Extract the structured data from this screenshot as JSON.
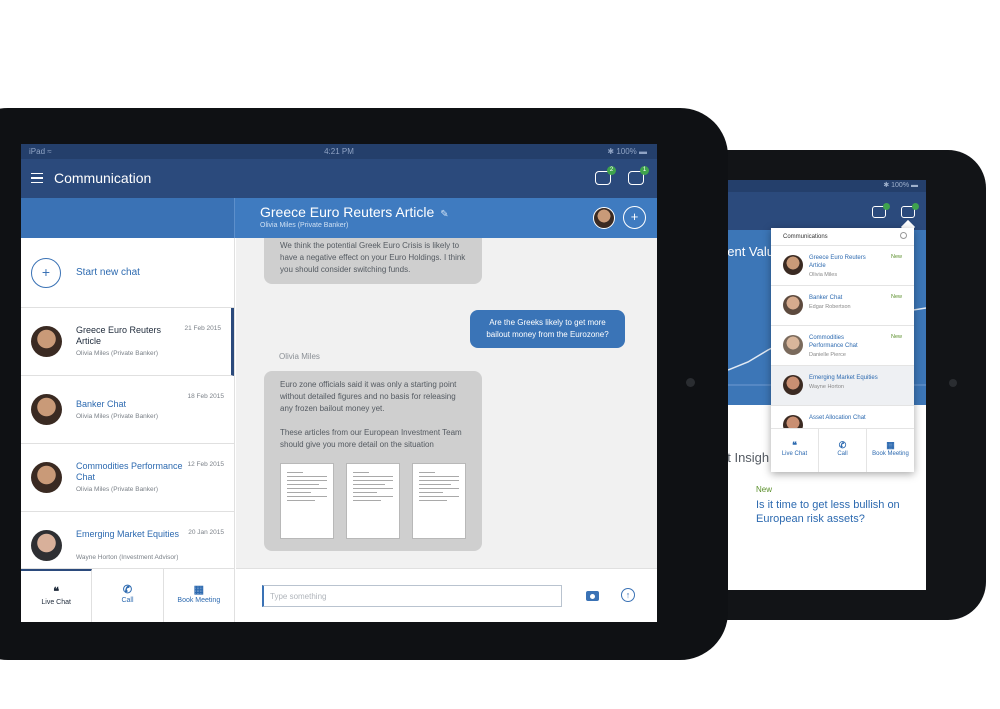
{
  "colors": {
    "header": "#2b4a7c",
    "accent": "#3a72b5",
    "new_badge": "#5a8f2a"
  },
  "status_bar": {
    "left": "iPad ≈",
    "time": "4:21 PM",
    "right": "✱ 100% ▬"
  },
  "header": {
    "title": "Communication",
    "notes_badge": "2",
    "chat_badge": "1"
  },
  "conversation": {
    "title": "Greece Euro Reuters Article",
    "subtitle": "Olivia Miles (Private Banker)",
    "messages": [
      {
        "id": "m1",
        "dir": "in",
        "text": "We think the potential Greek Euro Crisis is likely to have a negative effect on your Euro Holdings. I think you should consider switching funds."
      },
      {
        "id": "m2",
        "dir": "out",
        "text": "Are the Greeks likely to get more bailout money from the Eurozone?"
      },
      {
        "id": "m3",
        "dir": "in",
        "sender": "Olivia Miles",
        "text": "Euro zone officials said it was only a starting point without detailed figures and no basis for releasing any frozen bailout money yet.",
        "text2": "These articles from our European Investment Team should give you more detail on the situation"
      }
    ]
  },
  "sidebar": {
    "start_chat": "Start new chat",
    "chats": [
      {
        "name": "Greece Euro Reuters Article",
        "sub": "Olivia Miles (Private Banker)",
        "date": "21 Feb 2015"
      },
      {
        "name": "Banker Chat",
        "sub": "Olivia Miles (Private Banker)",
        "date": "18 Feb 2015"
      },
      {
        "name": "Commodities Performance Chat",
        "sub": "Olivia Miles (Private Banker)",
        "date": "12 Feb 2015"
      },
      {
        "name": "Emerging Market Equities",
        "sub": "Wayne Horton (Investment Advisor)",
        "date": "20 Jan 2015"
      }
    ]
  },
  "bottom_bar": [
    {
      "label": "Live Chat",
      "icon": "quote-icon"
    },
    {
      "label": "Call",
      "icon": "phone-icon"
    },
    {
      "label": "Book Meeting",
      "icon": "calendar-icon"
    }
  ],
  "composer": {
    "placeholder": "Type something"
  },
  "back_tablet": {
    "status": "✱ 100% ▬",
    "hero_title": "nent Valu",
    "insight_title": "et Insigh",
    "new_label": "New",
    "question": "Is it time to get less bullish on European risk assets?",
    "notes_badge": "2",
    "chat_badge": "1",
    "popover": {
      "title": "Communications",
      "items": [
        {
          "name": "Greece Euro Reuters Article",
          "sub": "Olivia Miles",
          "new": "New"
        },
        {
          "name": "Banker Chat",
          "sub": "Edgar Robertson",
          "new": "New"
        },
        {
          "name": "Commodities Performance Chat",
          "sub": "Danielle Pierce",
          "new": "New"
        },
        {
          "name": "Emerging Market Equities",
          "sub": "Wayne Horton",
          "new": ""
        },
        {
          "name": "Asset Allocation Chat",
          "sub": "",
          "new": ""
        }
      ],
      "actions": [
        {
          "label": "Live Chat",
          "icon": "quote-icon"
        },
        {
          "label": "Call",
          "icon": "phone-icon"
        },
        {
          "label": "Book Meeting",
          "icon": "calendar-icon"
        }
      ]
    }
  }
}
